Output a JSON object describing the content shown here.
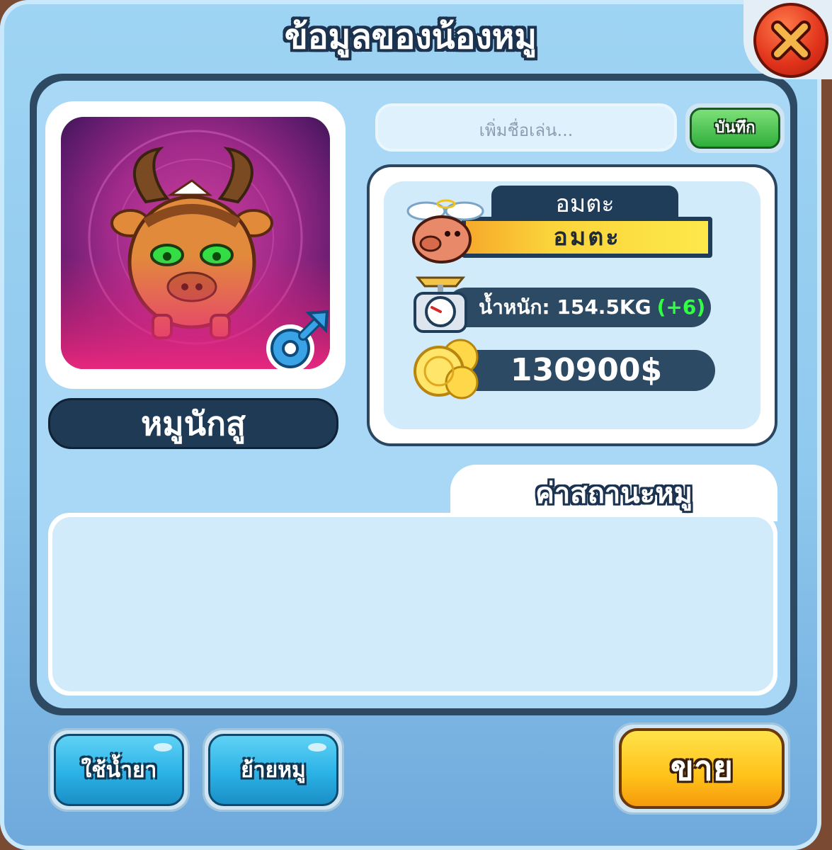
{
  "dialog": {
    "title": "ข้อมูลของน้องหมู"
  },
  "close": {
    "icon": "close-x-icon"
  },
  "pig": {
    "name": "หมูนักสู",
    "gender_icon": "male-symbol-icon",
    "portrait_icon": "horned-pig-portrait"
  },
  "nickname": {
    "placeholder": "เพิ่มชื่อเล่น...",
    "value": "",
    "save_label": "บันทึก"
  },
  "stats": {
    "rank_tab": "อมตะ",
    "rank_value": "อมตะ",
    "weight_label": "น้ำหนัก: 154.5KG",
    "weight_bonus": "(+6)",
    "money": "130900$"
  },
  "status_section": {
    "title": "ค่าสถานะหมู"
  },
  "buttons": {
    "use_potion": "ใช้น้ำยา",
    "move_pig": "ย้ายหมู",
    "sell": "ขาย"
  },
  "colors": {
    "dialog_bg": "#9fd4f3",
    "frame_dark": "#2d4a62",
    "accent_yellow": "#ffc21a",
    "bonus_green": "#33ff44",
    "button_blue": "#2bb2e6"
  }
}
